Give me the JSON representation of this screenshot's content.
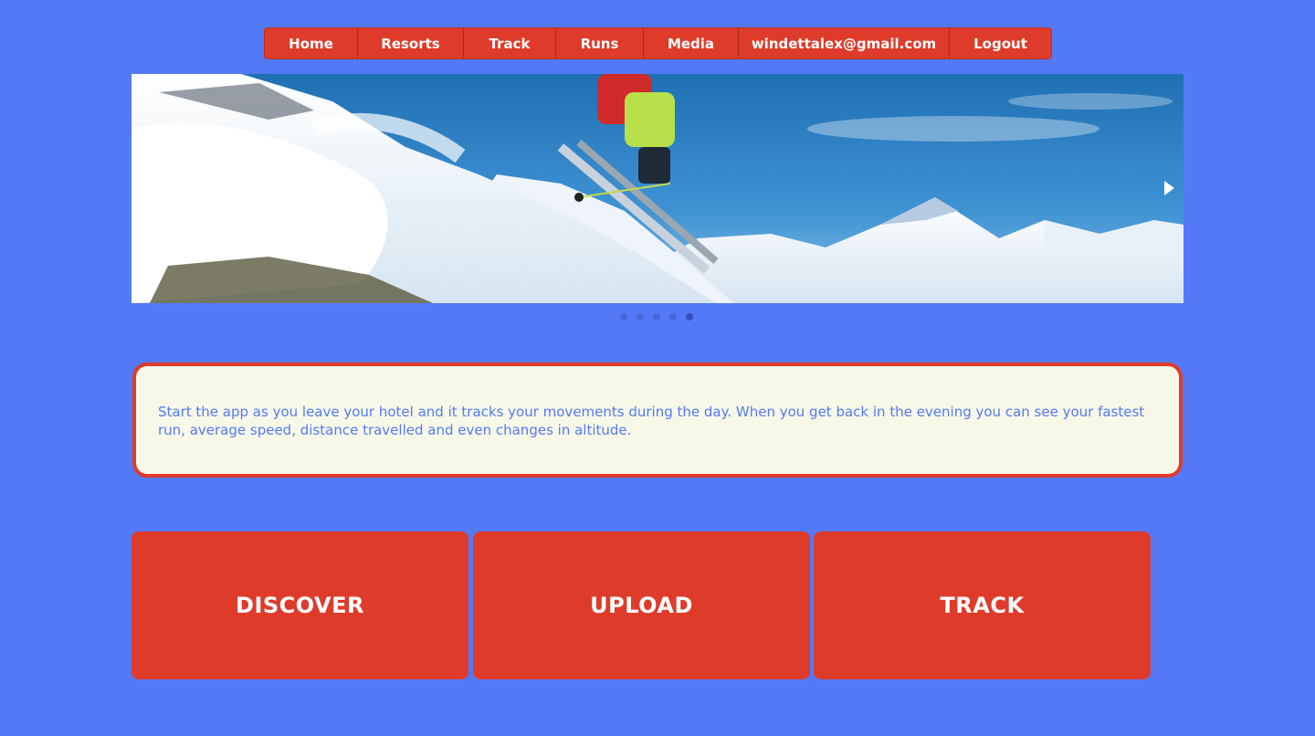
{
  "nav": {
    "items": [
      {
        "label": "Home"
      },
      {
        "label": "Resorts"
      },
      {
        "label": "Track"
      },
      {
        "label": "Runs"
      },
      {
        "label": "Media"
      },
      {
        "label": "windettalex@gmail.com"
      },
      {
        "label": "Logout"
      }
    ]
  },
  "carousel": {
    "prev_icon": "chevron-left-icon",
    "next_icon": "chevron-right-icon",
    "slide_count": 5,
    "active_slide": 5
  },
  "info": {
    "text": "Start the app as you leave your hotel and it tracks your movements during the day. When you get back in the evening you can see your fastest run, average speed, distance travelled and even changes in altitude."
  },
  "actions": [
    {
      "label": "DISCOVER"
    },
    {
      "label": "UPLOAD"
    },
    {
      "label": "TRACK"
    }
  ],
  "colors": {
    "background": "#5479f7",
    "accent": "#de3b2b",
    "info_bg": "#f7f8e8"
  }
}
